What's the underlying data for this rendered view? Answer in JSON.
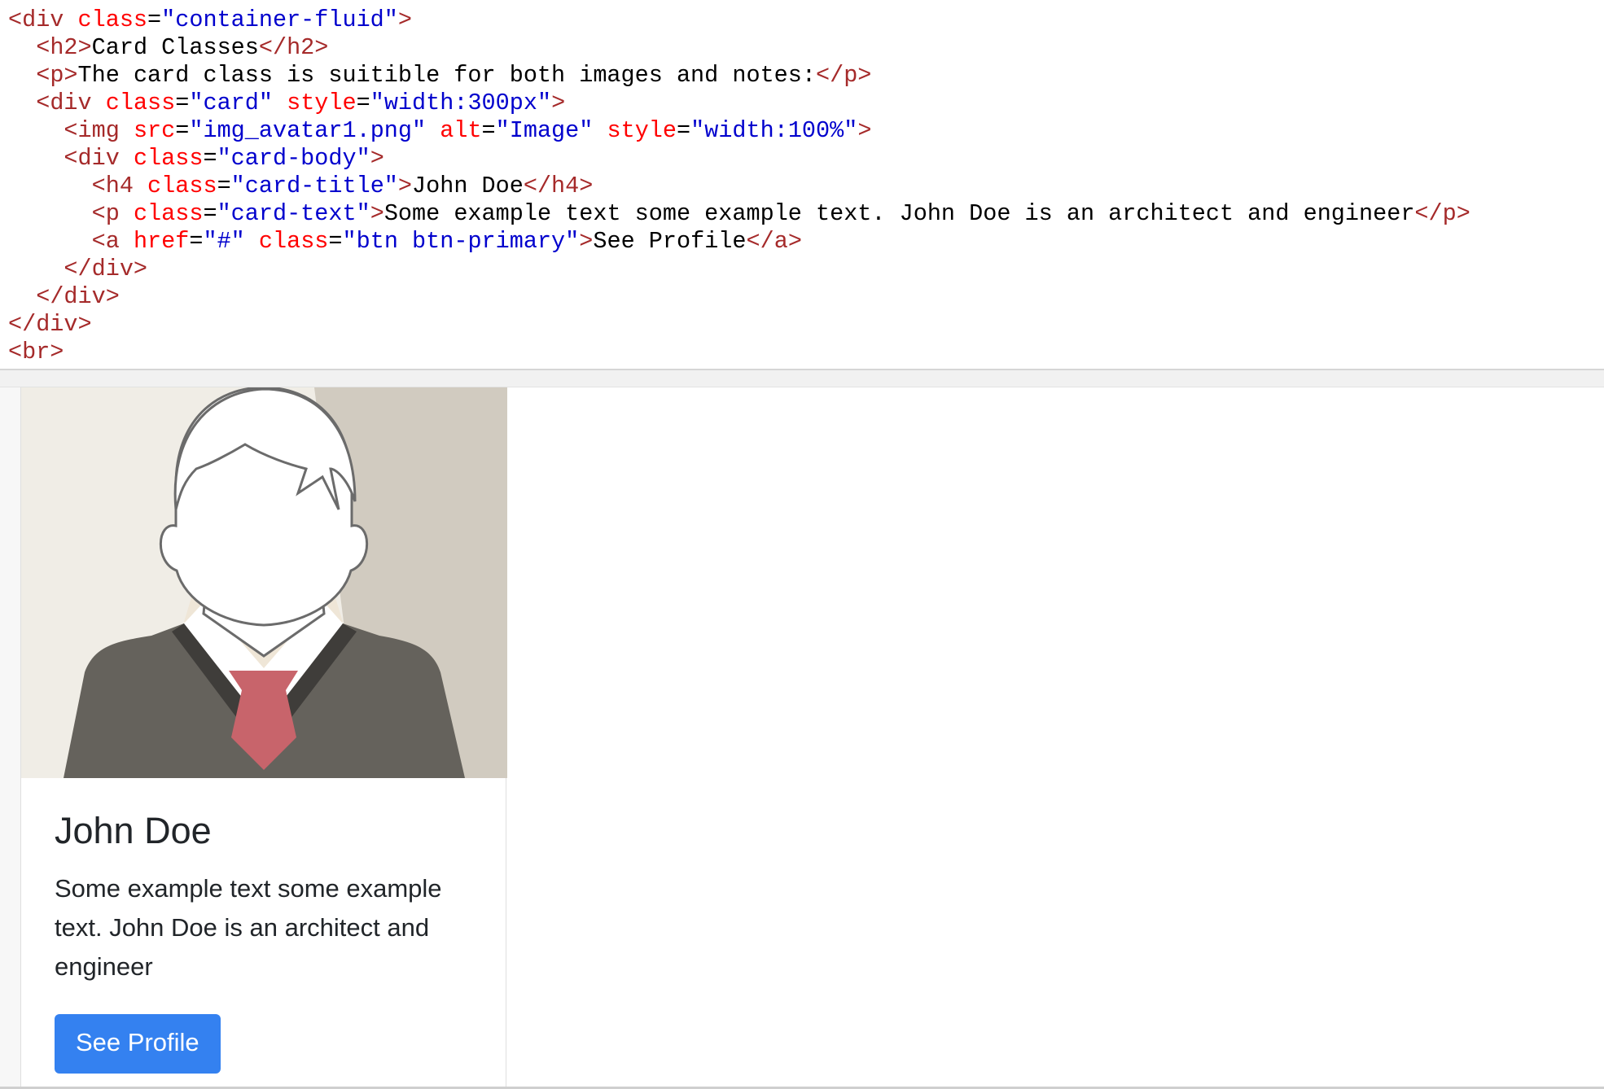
{
  "code": {
    "lines": [
      [
        {
          "c": "tag",
          "t": "<div "
        },
        {
          "c": "attr",
          "t": "class"
        },
        {
          "c": "",
          "t": "="
        },
        {
          "c": "val",
          "t": "\"container-fluid\""
        },
        {
          "c": "tag",
          "t": ">"
        }
      ],
      [
        {
          "c": "",
          "t": "  "
        },
        {
          "c": "tag",
          "t": "<h2>"
        },
        {
          "c": "",
          "t": "Card Classes"
        },
        {
          "c": "tag",
          "t": "</h2>"
        }
      ],
      [
        {
          "c": "",
          "t": "  "
        },
        {
          "c": "tag",
          "t": "<p>"
        },
        {
          "c": "",
          "t": "The card class is suitible for both images and notes:"
        },
        {
          "c": "tag",
          "t": "</p>"
        }
      ],
      [
        {
          "c": "",
          "t": "  "
        },
        {
          "c": "tag",
          "t": "<div "
        },
        {
          "c": "attr",
          "t": "class"
        },
        {
          "c": "",
          "t": "="
        },
        {
          "c": "val",
          "t": "\"card\""
        },
        {
          "c": "",
          "t": " "
        },
        {
          "c": "attr",
          "t": "style"
        },
        {
          "c": "",
          "t": "="
        },
        {
          "c": "val",
          "t": "\"width:300px\""
        },
        {
          "c": "tag",
          "t": ">"
        }
      ],
      [
        {
          "c": "",
          "t": "    "
        },
        {
          "c": "tag",
          "t": "<img "
        },
        {
          "c": "attr",
          "t": "src"
        },
        {
          "c": "",
          "t": "="
        },
        {
          "c": "val",
          "t": "\"img_avatar1.png\""
        },
        {
          "c": "",
          "t": " "
        },
        {
          "c": "attr",
          "t": "alt"
        },
        {
          "c": "",
          "t": "="
        },
        {
          "c": "val",
          "t": "\"Image\""
        },
        {
          "c": "",
          "t": " "
        },
        {
          "c": "attr",
          "t": "style"
        },
        {
          "c": "",
          "t": "="
        },
        {
          "c": "val",
          "t": "\"width:100%\""
        },
        {
          "c": "tag",
          "t": ">"
        }
      ],
      [
        {
          "c": "",
          "t": "    "
        },
        {
          "c": "tag",
          "t": "<div "
        },
        {
          "c": "attr",
          "t": "class"
        },
        {
          "c": "",
          "t": "="
        },
        {
          "c": "val",
          "t": "\"card-body\""
        },
        {
          "c": "tag",
          "t": ">"
        }
      ],
      [
        {
          "c": "",
          "t": "      "
        },
        {
          "c": "tag",
          "t": "<h4 "
        },
        {
          "c": "attr",
          "t": "class"
        },
        {
          "c": "",
          "t": "="
        },
        {
          "c": "val",
          "t": "\"card-title\""
        },
        {
          "c": "tag",
          "t": ">"
        },
        {
          "c": "",
          "t": "John Doe"
        },
        {
          "c": "tag",
          "t": "</h4>"
        }
      ],
      [
        {
          "c": "",
          "t": "      "
        },
        {
          "c": "tag",
          "t": "<p "
        },
        {
          "c": "attr",
          "t": "class"
        },
        {
          "c": "",
          "t": "="
        },
        {
          "c": "val",
          "t": "\"card-text\""
        },
        {
          "c": "tag",
          "t": ">"
        },
        {
          "c": "",
          "t": "Some example text some example text. John Doe is an architect and engineer"
        },
        {
          "c": "tag",
          "t": "</p>"
        }
      ],
      [
        {
          "c": "",
          "t": "      "
        },
        {
          "c": "tag",
          "t": "<a "
        },
        {
          "c": "attr",
          "t": "href"
        },
        {
          "c": "",
          "t": "="
        },
        {
          "c": "val",
          "t": "\"#\""
        },
        {
          "c": "",
          "t": " "
        },
        {
          "c": "attr",
          "t": "class"
        },
        {
          "c": "",
          "t": "="
        },
        {
          "c": "val",
          "t": "\"btn btn-primary\""
        },
        {
          "c": "tag",
          "t": ">"
        },
        {
          "c": "",
          "t": "See Profile"
        },
        {
          "c": "tag",
          "t": "</a>"
        }
      ],
      [
        {
          "c": "",
          "t": "    "
        },
        {
          "c": "tag",
          "t": "</div>"
        }
      ],
      [
        {
          "c": "",
          "t": "  "
        },
        {
          "c": "tag",
          "t": "</div>"
        }
      ],
      [
        {
          "c": "tag",
          "t": "</div>"
        }
      ],
      [
        {
          "c": "tag",
          "t": "<br>"
        }
      ]
    ]
  },
  "colors": {
    "tag": "#a52a2a",
    "attribute": "#ff0000",
    "value": "#0000cd",
    "button": "#3481f0"
  },
  "card": {
    "image_icon": "avatar-illustration",
    "title": "John Doe",
    "text": "Some example text some example text. John Doe is an architect and engineer",
    "button_label": "See Profile"
  }
}
